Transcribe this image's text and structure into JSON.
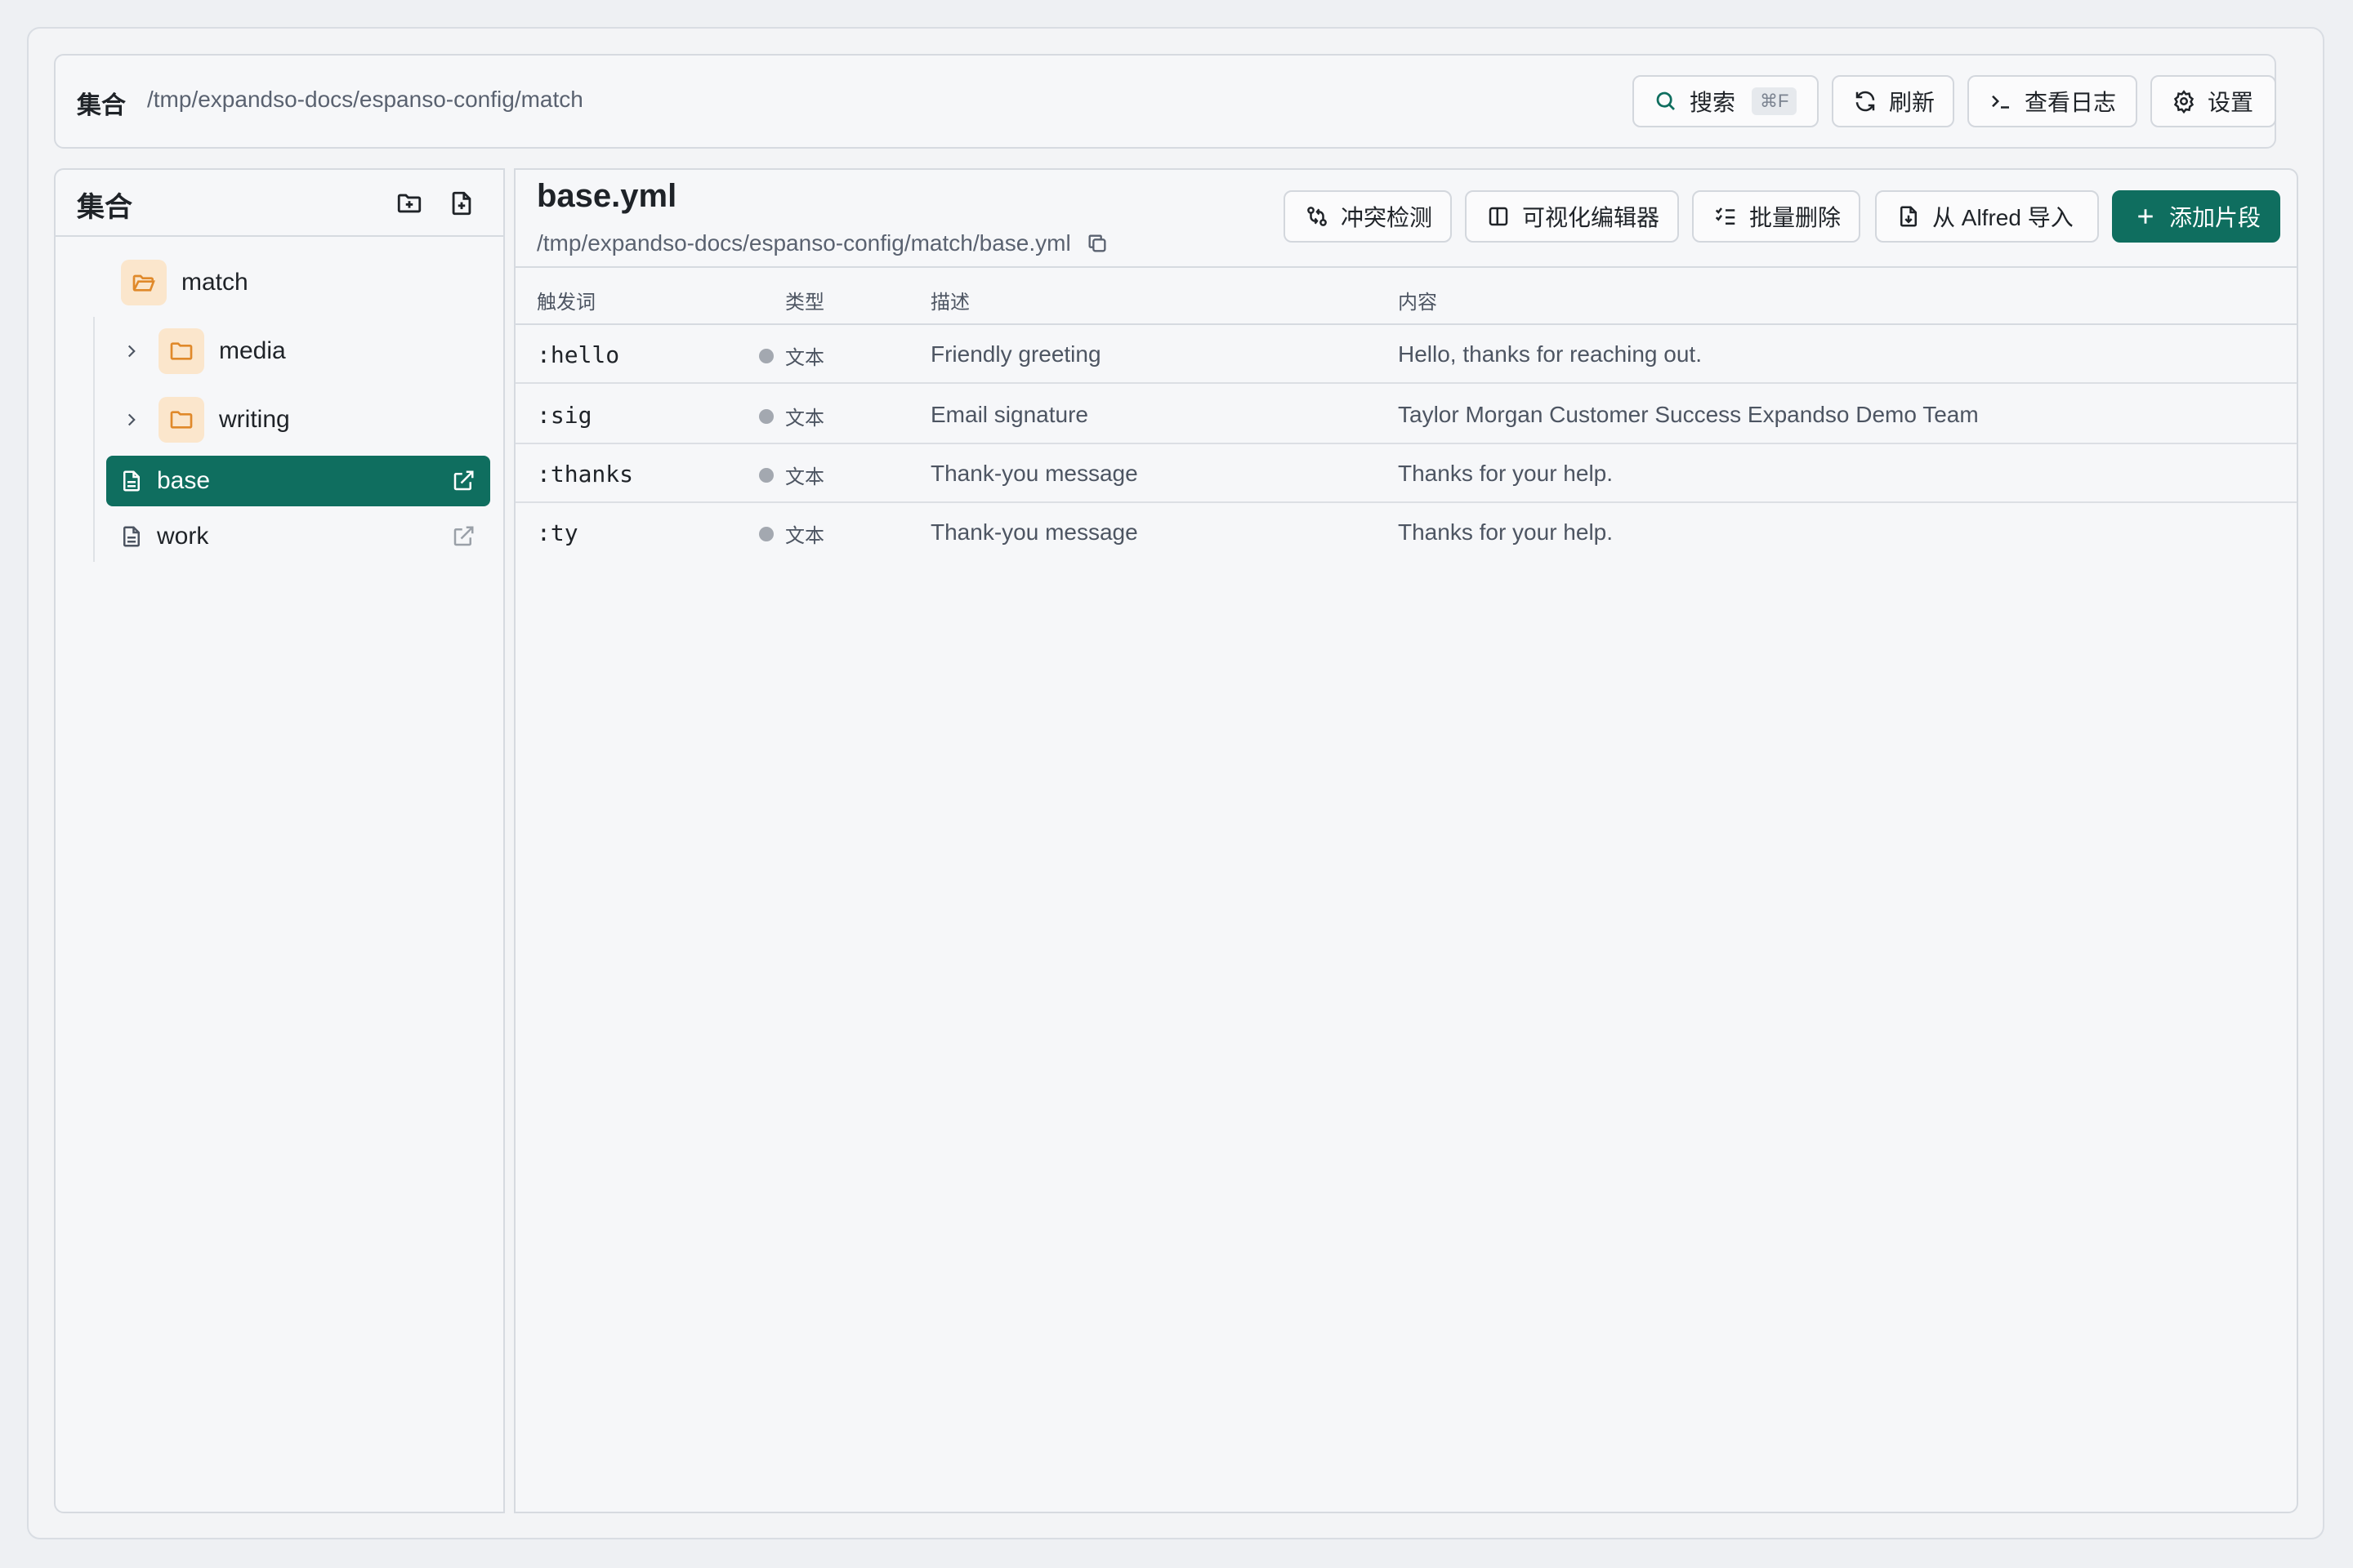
{
  "topbar": {
    "title": "集合",
    "path": "/tmp/expandso-docs/espanso-config/match",
    "search_label": "搜索",
    "search_shortcut": "⌘F",
    "refresh_label": "刷新",
    "logs_label": "查看日志",
    "settings_label": "设置"
  },
  "sidebar": {
    "title": "集合",
    "root_folder": "match",
    "folders": [
      {
        "label": "media"
      },
      {
        "label": "writing"
      }
    ],
    "files": [
      {
        "label": "base",
        "selected": true
      },
      {
        "label": "work",
        "selected": false
      }
    ]
  },
  "main": {
    "file_title": "base.yml",
    "file_path": "/tmp/expandso-docs/espanso-config/match/base.yml",
    "toolbar": {
      "conflict_label": "冲突检测",
      "visual_editor_label": "可视化编辑器",
      "bulk_delete_label": "批量删除",
      "import_label": "从 Alfred 导入",
      "add_label": "添加片段"
    },
    "columns": {
      "trigger": "触发词",
      "type": "类型",
      "description": "描述",
      "content": "内容"
    },
    "rows": [
      {
        "trigger": ":hello",
        "type": "文本",
        "description": "Friendly greeting",
        "content": "Hello, thanks for reaching out."
      },
      {
        "trigger": ":sig",
        "type": "文本",
        "description": "Email signature",
        "content": "Taylor Morgan Customer Success Expandso Demo Team"
      },
      {
        "trigger": ":thanks",
        "type": "文本",
        "description": "Thank-you message",
        "content": "Thanks for your help."
      },
      {
        "trigger": ":ty",
        "type": "文本",
        "description": "Thank-you message",
        "content": "Thanks for your help."
      }
    ]
  },
  "colors": {
    "accent": "#0f6e5f",
    "folder_bg": "#fbe6cc",
    "folder_icon": "#e0892a"
  }
}
